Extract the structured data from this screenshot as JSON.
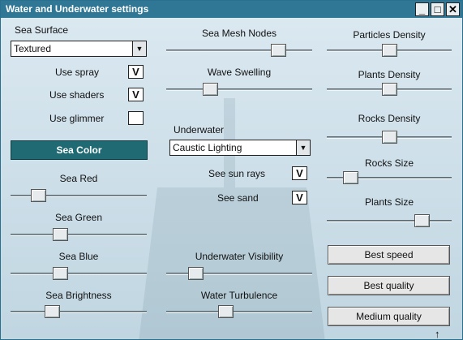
{
  "window": {
    "title": "Water and Underwater settings",
    "buttons": [
      "_",
      "□",
      "✕"
    ]
  },
  "left": {
    "sea_surface_label": "Sea Surface",
    "sea_surface_value": "Textured",
    "use_spray": {
      "label": "Use spray",
      "checked": true
    },
    "use_shaders": {
      "label": "Use shaders",
      "checked": true
    },
    "use_glimmer": {
      "label": "Use glimmer",
      "checked": false
    },
    "sea_color_button": "Sea Color",
    "sea_red": {
      "label": "Sea Red",
      "value": 0.17
    },
    "sea_green": {
      "label": "Sea Green",
      "value": 0.35
    },
    "sea_blue": {
      "label": "Sea Blue",
      "value": 0.35
    },
    "sea_brightness": {
      "label": "Sea Brightness",
      "value": 0.28
    }
  },
  "middle": {
    "mesh_nodes": {
      "label": "Sea Mesh Nodes",
      "value": 0.8
    },
    "wave_swelling": {
      "label": "Wave Swelling",
      "value": 0.28
    },
    "underwater_label": "Underwater",
    "underwater_value": "Caustic Lighting",
    "see_sun_rays": {
      "label": "See sun rays",
      "checked": true
    },
    "see_sand": {
      "label": "See sand",
      "checked": true
    },
    "visibility": {
      "label": "Underwater Visibility",
      "value": 0.17
    },
    "turbulence": {
      "label": "Water Turbulence",
      "value": 0.4
    }
  },
  "right": {
    "particles_density": {
      "label": "Particles Density",
      "value": 0.5
    },
    "plants_density": {
      "label": "Plants Density",
      "value": 0.5
    },
    "rocks_density": {
      "label": "Rocks Density",
      "value": 0.5
    },
    "rocks_size": {
      "label": "Rocks Size",
      "value": 0.15
    },
    "plants_size": {
      "label": "Plants Size",
      "value": 0.8
    },
    "best_speed": "Best speed",
    "best_quality": "Best quality",
    "medium_quality": "Medium quality"
  },
  "check_mark": "V",
  "combo_arrow": "▼"
}
